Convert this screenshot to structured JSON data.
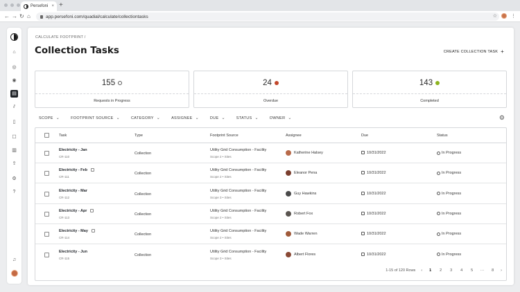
{
  "browser": {
    "tab_title": "Persefoni",
    "tab_close": "×",
    "new_tab": "+",
    "url": "app.persefoni.com/quadial/calculate/collectiontasks",
    "back": "←",
    "forward": "→",
    "reload": "↻",
    "home": "⌂",
    "star": "☆",
    "menu": "⋮"
  },
  "header": {
    "breadcrumb": "CALCULATE FOOTPRINT /",
    "title": "Collection Tasks",
    "create_label": "CREATE COLLECTION TASK",
    "create_icon": "+"
  },
  "stats": [
    {
      "value": "155",
      "label": "Requests in Progress",
      "icon": "progress-icon"
    },
    {
      "value": "24",
      "label": "Overdue",
      "icon": "overdue-icon",
      "color": "#c2472b"
    },
    {
      "value": "143",
      "label": "Completed",
      "icon": "completed-icon",
      "color": "#8cb31f"
    }
  ],
  "filters": [
    "SCOPE",
    "FOOTPRINT SOURCE",
    "CATEGORY",
    "ASSIGNEE",
    "DUE",
    "STATUS",
    "OWNER"
  ],
  "filter_chevron": "⌄",
  "settings_icon": "⚙",
  "table": {
    "columns": [
      "Task",
      "Type",
      "Footprint Source",
      "Assignee",
      "Due",
      "Status"
    ],
    "rows": [
      {
        "task": "Electricity - Jan",
        "id": "CR-110",
        "type": "Collection",
        "source": "Utility Grid Consumption - Facility",
        "scope": "Scope 2 • Sites",
        "assignee": "Katherine Halsey",
        "due": "10/31/2022",
        "status": "In Progress",
        "avatar_color": "#b86a4a",
        "ds_icon": false
      },
      {
        "task": "Electricity - Feb",
        "id": "CR-111",
        "type": "Collection",
        "source": "Utility Grid Consumption - Facility",
        "scope": "Scope 2 • Sites",
        "assignee": "Eleanor Pena",
        "due": "10/31/2022",
        "status": "In Progress",
        "avatar_color": "#7a3e2e",
        "ds_icon": true
      },
      {
        "task": "Electricity - Mar",
        "id": "CR-112",
        "type": "Collection",
        "source": "Utility Grid Consumption - Facility",
        "scope": "Scope 3 • Sites",
        "assignee": "Guy Hawkins",
        "due": "10/31/2022",
        "status": "In Progress",
        "avatar_color": "#4a4a4a",
        "ds_icon": false
      },
      {
        "task": "Electricity - Apr",
        "id": "CR-113",
        "type": "Collection",
        "source": "Utility Grid Consumption - Facility",
        "scope": "Scope 2 • Sites",
        "assignee": "Robert Fox",
        "due": "10/31/2022",
        "status": "In Progress",
        "avatar_color": "#5a5550",
        "ds_icon": true
      },
      {
        "task": "Electricity - May",
        "id": "CR-114",
        "type": "Collection",
        "source": "Utility Grid Consumption - Facility",
        "scope": "Scope 2 • Sites",
        "assignee": "Wade Warren",
        "due": "10/31/2022",
        "status": "In Progress",
        "avatar_color": "#a05a3a",
        "ds_icon": true
      },
      {
        "task": "Electricity - Jun",
        "id": "CR-115",
        "type": "Collection",
        "source": "Utility Grid Consumption - Facility",
        "scope": "Scope 3 • Sites",
        "assignee": "Albert Flores",
        "due": "10/31/2022",
        "status": "In Progress",
        "avatar_color": "#8a4a36",
        "ds_icon": false
      }
    ]
  },
  "pagination": {
    "summary": "1-15 of 120 Rows",
    "prev": "‹",
    "next": "›",
    "pages": [
      "1",
      "2",
      "3",
      "4",
      "5",
      "···",
      "8"
    ],
    "current": "1"
  }
}
